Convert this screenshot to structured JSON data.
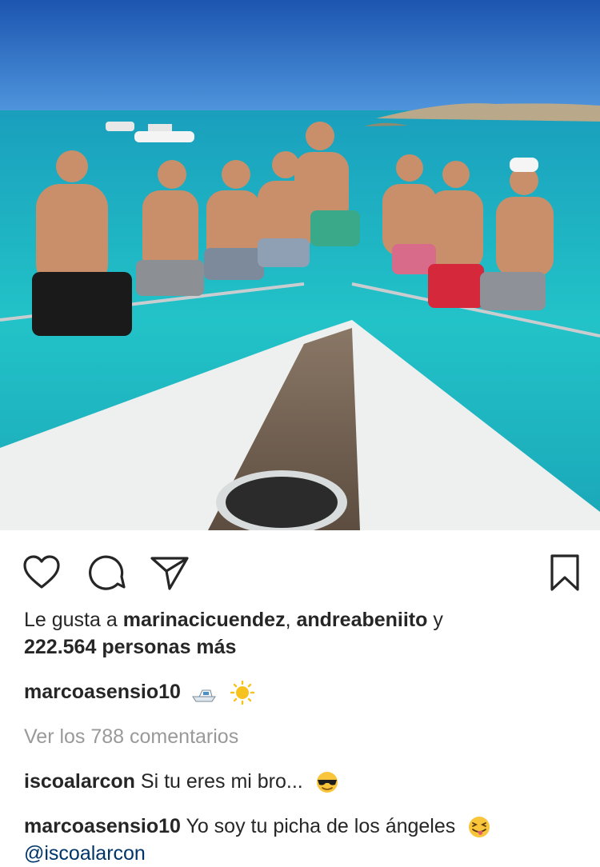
{
  "post": {
    "image_alt": "Group of friends on a boat bow over turquoise sea",
    "colors": {
      "sea": "#1ab4c8",
      "sky": "#2f6fc4",
      "boat": "#f2f2f2",
      "deck": "#6b5a4c"
    }
  },
  "actions": {
    "like_icon": "heart-icon",
    "comment_icon": "speech-bubble-icon",
    "share_icon": "paper-plane-icon",
    "save_icon": "bookmark-icon"
  },
  "likes": {
    "prefix": "Le gusta a ",
    "user1": "marinacicuendez",
    "separator": ", ",
    "user2": "andreabeniito",
    "conjunction": " y",
    "count_text": "222.564 personas más"
  },
  "caption": {
    "username": "marcoasensio10",
    "emojis": [
      "speedboat-emoji",
      "sun-emoji"
    ]
  },
  "view_comments": "Ver los 788 comentarios",
  "comments": [
    {
      "username": "iscoalarcon",
      "text": " Si tu eres mi bro...",
      "emoji": "sunglasses-emoji"
    },
    {
      "username": "marcoasensio10",
      "text": " Yo soy tu picha de los ángeles",
      "emoji": "tongue-wink-emoji",
      "mention": "@iscoalarcon"
    }
  ]
}
